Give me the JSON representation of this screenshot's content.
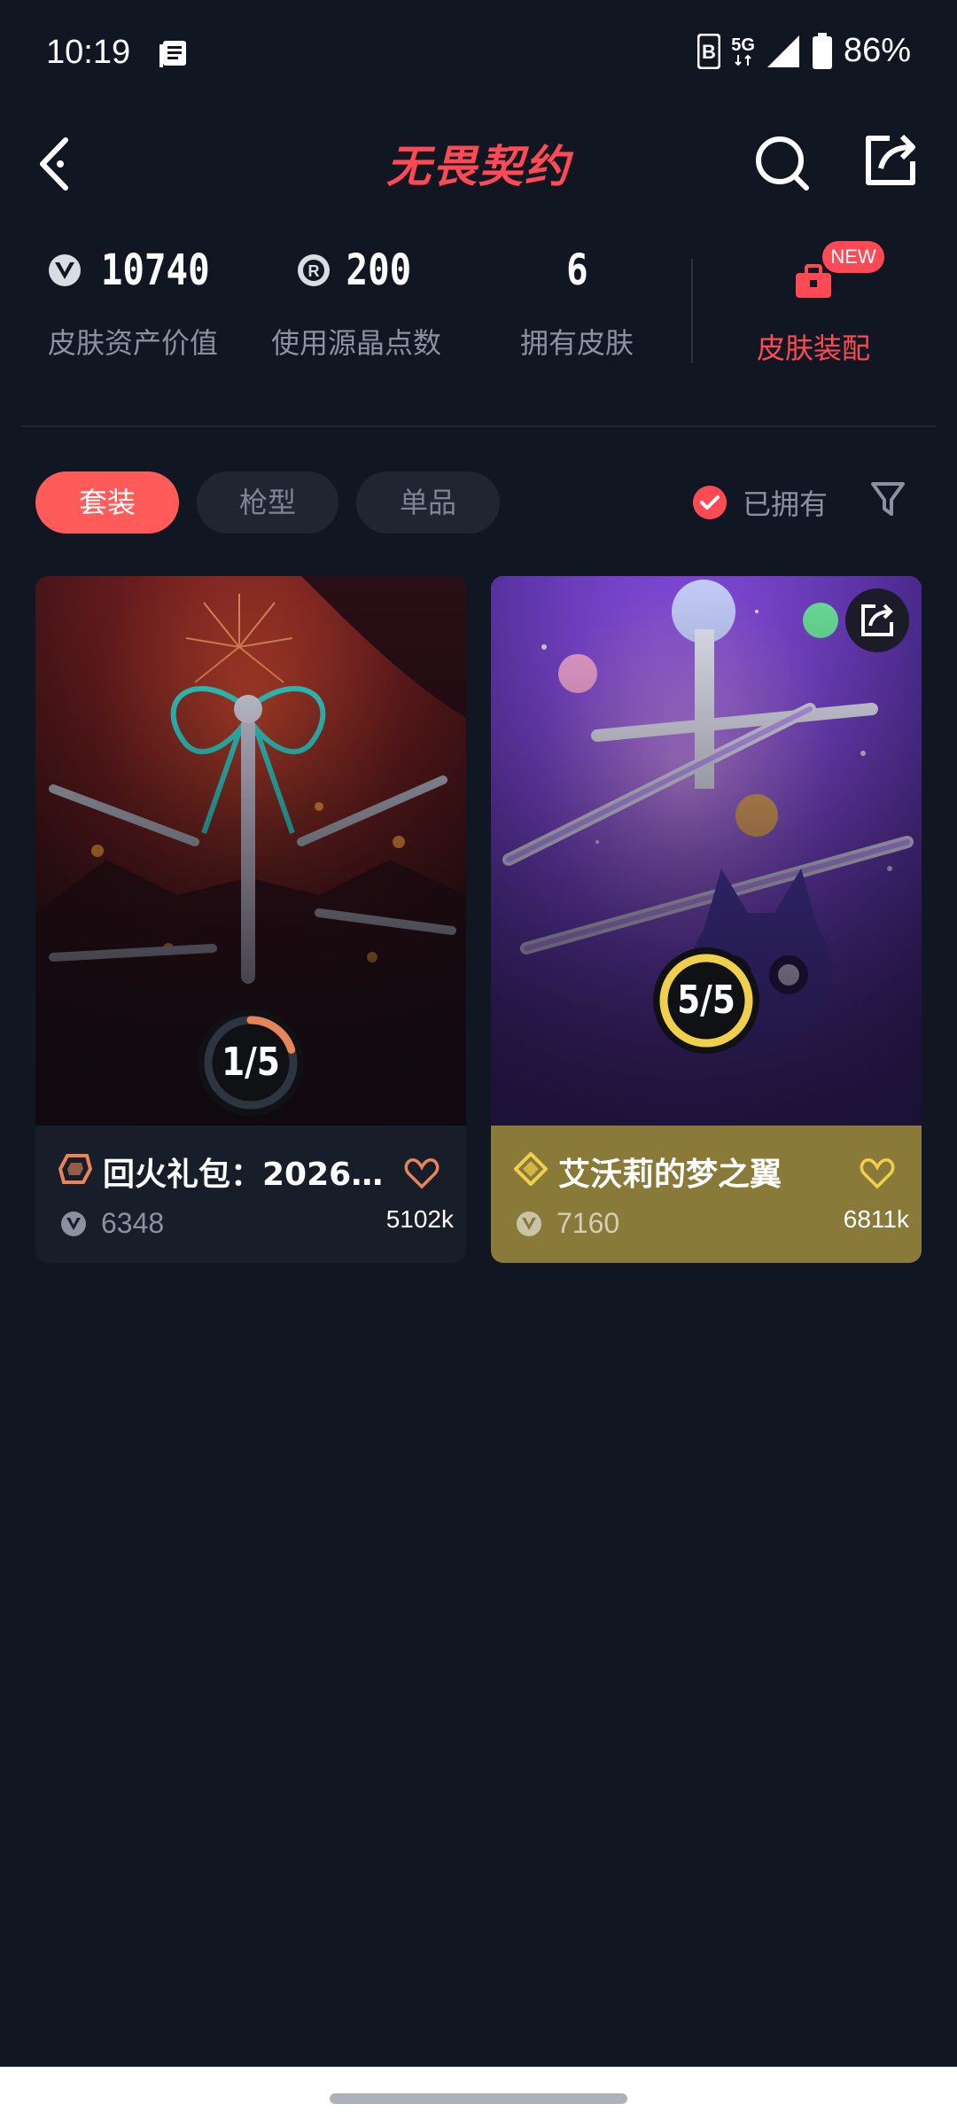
{
  "status_bar": {
    "time": "10:19",
    "network": "5G",
    "battery": "86%"
  },
  "header": {
    "title": "无畏契约"
  },
  "stats": {
    "asset_value": {
      "value": "10740",
      "label": "皮肤资产价值"
    },
    "radianite": {
      "value": "200",
      "label": "使用源晶点数"
    },
    "owned_skins": {
      "value": "6",
      "label": "拥有皮肤"
    },
    "equip": {
      "label": "皮肤装配",
      "badge": "NEW"
    }
  },
  "filters": {
    "tabs": [
      {
        "label": "套装",
        "active": true
      },
      {
        "label": "枪型",
        "active": false
      },
      {
        "label": "单品",
        "active": false
      }
    ],
    "owned_label": "已拥有"
  },
  "cards": [
    {
      "title": "回火礼包：2026...",
      "price": "6348",
      "likes": "5102k",
      "progress": "1/5",
      "progress_fraction": 0.2,
      "tier_color": "#e8845a",
      "heart_color": "#e8845a"
    },
    {
      "title": "艾沃莉的梦之翼",
      "price": "7160",
      "likes": "6811k",
      "progress": "5/5",
      "progress_fraction": 1.0,
      "tier_color": "#f0d04a",
      "heart_color": "#f0d04a"
    }
  ],
  "colors": {
    "accent": "#ff4a55",
    "background": "#101722",
    "card_gold": "#8a7a3a"
  }
}
